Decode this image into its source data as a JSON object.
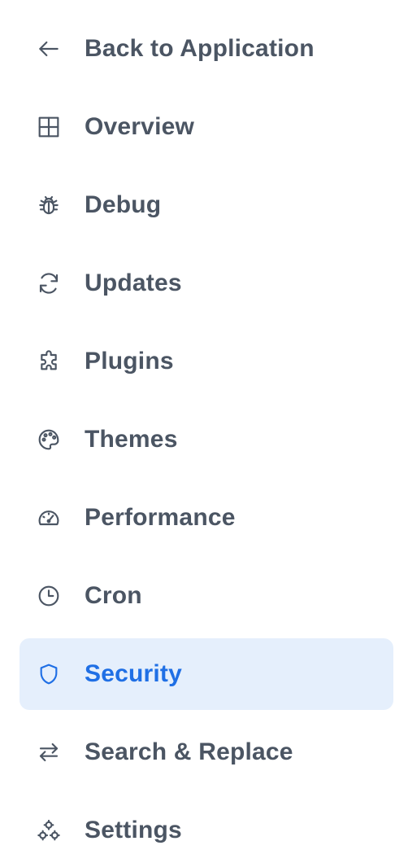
{
  "sidebar": {
    "back": {
      "label": "Back to Application",
      "icon": "arrow-left-icon"
    },
    "items": [
      {
        "label": "Overview",
        "icon": "grid-icon",
        "active": false
      },
      {
        "label": "Debug",
        "icon": "bug-icon",
        "active": false
      },
      {
        "label": "Updates",
        "icon": "refresh-icon",
        "active": false
      },
      {
        "label": "Plugins",
        "icon": "puzzle-icon",
        "active": false
      },
      {
        "label": "Themes",
        "icon": "palette-icon",
        "active": false
      },
      {
        "label": "Performance",
        "icon": "gauge-icon",
        "active": false
      },
      {
        "label": "Cron",
        "icon": "clock-icon",
        "active": false
      },
      {
        "label": "Security",
        "icon": "shield-icon",
        "active": true
      },
      {
        "label": "Search & Replace",
        "icon": "arrows-swap-icon",
        "active": false
      },
      {
        "label": "Settings",
        "icon": "cogs-icon",
        "active": false
      }
    ]
  },
  "colors": {
    "text": "#4b5563",
    "active_text": "#1f6fe5",
    "active_background": "#e5effc"
  }
}
